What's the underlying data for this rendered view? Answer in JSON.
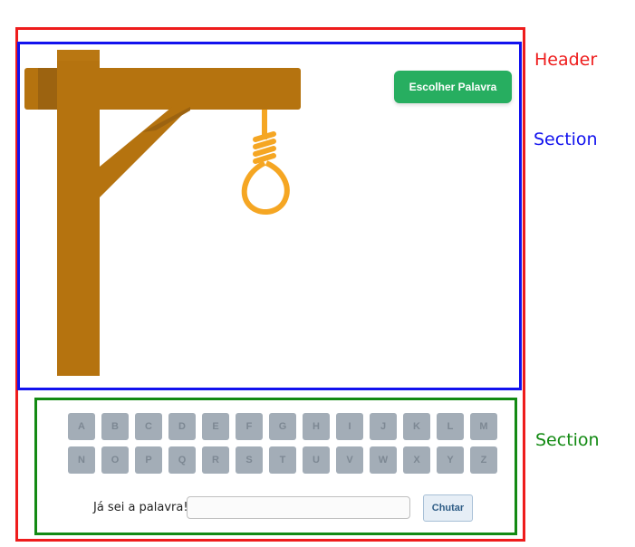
{
  "annotations": {
    "header_label": "Header",
    "section1_label": "Section",
    "section2_label": "Section",
    "header_color": "#ee1c1c",
    "section1_color": "#1212ee",
    "section2_color": "#138a13"
  },
  "header": {
    "choose_button_label": "Escolher Palavra",
    "choose_button_color": "#27ae60"
  },
  "gallows": {
    "wood_color": "#b5730f",
    "wood_shade_color": "#9c6310",
    "rope_color": "#f5a623"
  },
  "keyboard": {
    "rows": [
      [
        "A",
        "B",
        "C",
        "D",
        "E",
        "F",
        "G",
        "H",
        "I",
        "J",
        "K",
        "L",
        "M"
      ],
      [
        "N",
        "O",
        "P",
        "Q",
        "R",
        "S",
        "T",
        "U",
        "V",
        "W",
        "X",
        "Y",
        "Z"
      ]
    ]
  },
  "guess": {
    "label": "Já sei a palavra!",
    "input_value": "",
    "input_placeholder": "",
    "button_label": "Chutar"
  }
}
